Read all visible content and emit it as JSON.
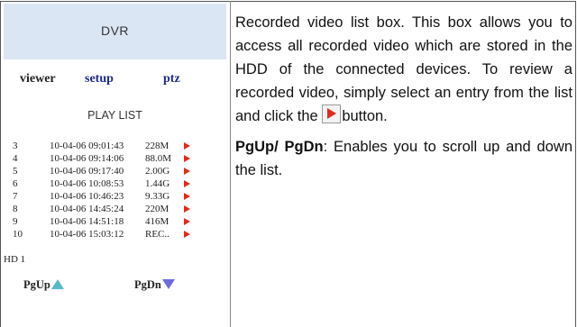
{
  "dvr": {
    "title": "DVR",
    "nav": {
      "viewer": "viewer",
      "setup": "setup",
      "ptz": "ptz"
    },
    "playlist_title": "PLAY LIST",
    "entries": [
      {
        "num": "3",
        "datetime": "10-04-06 09:01:43",
        "size": "228M"
      },
      {
        "num": "4",
        "datetime": "10-04-06 09:14:06",
        "size": "88.0M"
      },
      {
        "num": "5",
        "datetime": "10-04-06 09:17:40",
        "size": "2.00G"
      },
      {
        "num": "6",
        "datetime": "10-04-06 10:08:53",
        "size": "1.44G"
      },
      {
        "num": "7",
        "datetime": "10-04-06 10:46:23",
        "size": "9.33G"
      },
      {
        "num": "8",
        "datetime": "10-04-06 14:45:24",
        "size": "220M"
      },
      {
        "num": "9",
        "datetime": "10-04-06 14:51:18",
        "size": "416M"
      },
      {
        "num": "10",
        "datetime": "10-04-06 15:03:12",
        "size": "REC.."
      }
    ],
    "hd_label": "HD 1",
    "pgup": "PgUp",
    "pgdn": "PgDn",
    "colors": {
      "header_bg": "#dbe6f5",
      "nav_link": "#1f2a8a",
      "play_icon": "#e22a1c",
      "pgup_arrow": "#58b9c9",
      "pgdn_arrow": "#6e6ce0"
    }
  },
  "description": {
    "para1_a": "Recorded video list box. This box allows you to access all recorded video which are stored in the HDD of the connected devices. To review a recorded video, simply select an entry from the list and click the",
    "para1_b": "button.",
    "para2_bold": "PgUp/ PgDn",
    "para2_rest": ": Enables you to scroll up and down the list."
  }
}
